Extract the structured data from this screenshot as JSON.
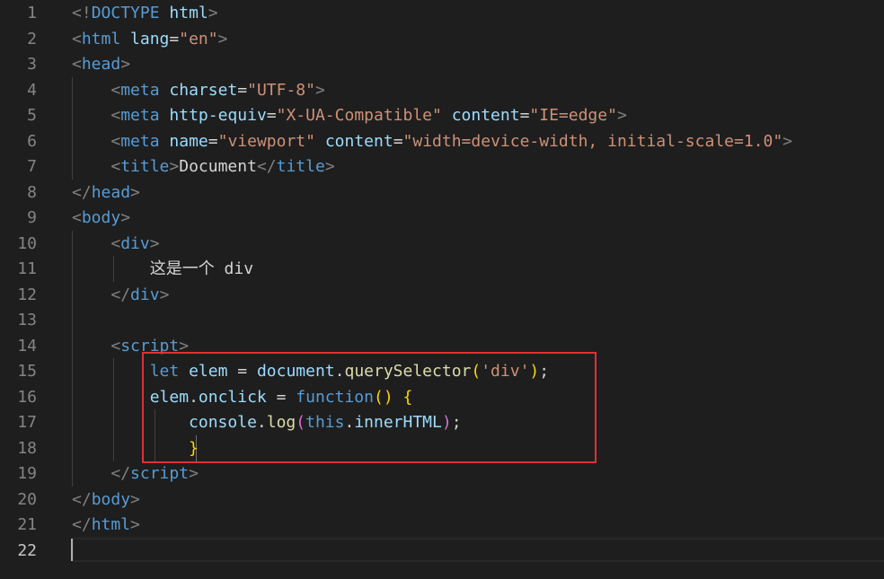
{
  "editor": {
    "theme": "dark",
    "accent": "#e03131",
    "current_line": 22,
    "highlight_box": {
      "from_line": 15,
      "to_line": 18
    },
    "lines": [
      {
        "num": "1",
        "tokens": [
          [
            "<!",
            "#808080"
          ],
          [
            "DOCTYPE",
            "#569cd6"
          ],
          [
            " ",
            "#d4d4d4"
          ],
          [
            "html",
            "#9cdcfe"
          ],
          [
            ">",
            "#808080"
          ]
        ]
      },
      {
        "num": "2",
        "tokens": [
          [
            "<",
            "#808080"
          ],
          [
            "html",
            "#569cd6"
          ],
          [
            " ",
            "#d4d4d4"
          ],
          [
            "lang",
            "#9cdcfe"
          ],
          [
            "=",
            "#d4d4d4"
          ],
          [
            "\"en\"",
            "#ce9178"
          ],
          [
            ">",
            "#808080"
          ]
        ]
      },
      {
        "num": "3",
        "tokens": [
          [
            "<",
            "#808080"
          ],
          [
            "head",
            "#569cd6"
          ],
          [
            ">",
            "#808080"
          ]
        ]
      },
      {
        "num": "4",
        "tokens": [
          [
            "    ",
            "#d4d4d4"
          ],
          [
            "<",
            "#808080"
          ],
          [
            "meta",
            "#569cd6"
          ],
          [
            " ",
            "#d4d4d4"
          ],
          [
            "charset",
            "#9cdcfe"
          ],
          [
            "=",
            "#d4d4d4"
          ],
          [
            "\"UTF-8\"",
            "#ce9178"
          ],
          [
            ">",
            "#808080"
          ]
        ]
      },
      {
        "num": "5",
        "tokens": [
          [
            "    ",
            "#d4d4d4"
          ],
          [
            "<",
            "#808080"
          ],
          [
            "meta",
            "#569cd6"
          ],
          [
            " ",
            "#d4d4d4"
          ],
          [
            "http-equiv",
            "#9cdcfe"
          ],
          [
            "=",
            "#d4d4d4"
          ],
          [
            "\"X-UA-Compatible\"",
            "#ce9178"
          ],
          [
            " ",
            "#d4d4d4"
          ],
          [
            "content",
            "#9cdcfe"
          ],
          [
            "=",
            "#d4d4d4"
          ],
          [
            "\"IE=edge\"",
            "#ce9178"
          ],
          [
            ">",
            "#808080"
          ]
        ]
      },
      {
        "num": "6",
        "tokens": [
          [
            "    ",
            "#d4d4d4"
          ],
          [
            "<",
            "#808080"
          ],
          [
            "meta",
            "#569cd6"
          ],
          [
            " ",
            "#d4d4d4"
          ],
          [
            "name",
            "#9cdcfe"
          ],
          [
            "=",
            "#d4d4d4"
          ],
          [
            "\"viewport\"",
            "#ce9178"
          ],
          [
            " ",
            "#d4d4d4"
          ],
          [
            "content",
            "#9cdcfe"
          ],
          [
            "=",
            "#d4d4d4"
          ],
          [
            "\"width=device-width, initial-scale=1.0\"",
            "#ce9178"
          ],
          [
            ">",
            "#808080"
          ]
        ]
      },
      {
        "num": "7",
        "tokens": [
          [
            "    ",
            "#d4d4d4"
          ],
          [
            "<",
            "#808080"
          ],
          [
            "title",
            "#569cd6"
          ],
          [
            ">",
            "#808080"
          ],
          [
            "Document",
            "#d4d4d4"
          ],
          [
            "</",
            "#808080"
          ],
          [
            "title",
            "#569cd6"
          ],
          [
            ">",
            "#808080"
          ]
        ]
      },
      {
        "num": "8",
        "tokens": [
          [
            "</",
            "#808080"
          ],
          [
            "head",
            "#569cd6"
          ],
          [
            ">",
            "#808080"
          ]
        ]
      },
      {
        "num": "9",
        "tokens": [
          [
            "<",
            "#808080"
          ],
          [
            "body",
            "#569cd6"
          ],
          [
            ">",
            "#808080"
          ]
        ]
      },
      {
        "num": "10",
        "tokens": [
          [
            "    ",
            "#d4d4d4"
          ],
          [
            "<",
            "#808080"
          ],
          [
            "div",
            "#569cd6"
          ],
          [
            ">",
            "#808080"
          ]
        ]
      },
      {
        "num": "11",
        "tokens": [
          [
            "        ",
            "#d4d4d4"
          ],
          [
            "这是一个 div",
            "#d4d4d4"
          ]
        ]
      },
      {
        "num": "12",
        "tokens": [
          [
            "    ",
            "#d4d4d4"
          ],
          [
            "</",
            "#808080"
          ],
          [
            "div",
            "#569cd6"
          ],
          [
            ">",
            "#808080"
          ]
        ]
      },
      {
        "num": "13",
        "tokens": []
      },
      {
        "num": "14",
        "tokens": [
          [
            "    ",
            "#d4d4d4"
          ],
          [
            "<",
            "#808080"
          ],
          [
            "script",
            "#569cd6"
          ],
          [
            ">",
            "#808080"
          ]
        ]
      },
      {
        "num": "15",
        "tokens": [
          [
            "        ",
            "#d4d4d4"
          ],
          [
            "let",
            "#569cd6"
          ],
          [
            " ",
            "#d4d4d4"
          ],
          [
            "elem",
            "#9cdcfe"
          ],
          [
            " = ",
            "#d4d4d4"
          ],
          [
            "document",
            "#9cdcfe"
          ],
          [
            ".",
            "#d4d4d4"
          ],
          [
            "querySelector",
            "#dcdcaa"
          ],
          [
            "(",
            "#ffd700"
          ],
          [
            "'div'",
            "#ce9178"
          ],
          [
            ")",
            "#ffd700"
          ],
          [
            ";",
            "#d4d4d4"
          ]
        ]
      },
      {
        "num": "16",
        "tokens": [
          [
            "        ",
            "#d4d4d4"
          ],
          [
            "elem",
            "#9cdcfe"
          ],
          [
            ".",
            "#d4d4d4"
          ],
          [
            "onclick",
            "#9cdcfe"
          ],
          [
            " = ",
            "#d4d4d4"
          ],
          [
            "function",
            "#569cd6"
          ],
          [
            "()",
            "#ffd700"
          ],
          [
            " ",
            "#d4d4d4"
          ],
          [
            "{",
            "#ffd700"
          ]
        ]
      },
      {
        "num": "17",
        "tokens": [
          [
            "            ",
            "#d4d4d4"
          ],
          [
            "console",
            "#9cdcfe"
          ],
          [
            ".",
            "#d4d4d4"
          ],
          [
            "log",
            "#dcdcaa"
          ],
          [
            "(",
            "#da70d6"
          ],
          [
            "this",
            "#569cd6"
          ],
          [
            ".",
            "#d4d4d4"
          ],
          [
            "innerHTML",
            "#9cdcfe"
          ],
          [
            ")",
            "#da70d6"
          ],
          [
            ";",
            "#d4d4d4"
          ]
        ]
      },
      {
        "num": "18",
        "tokens": [
          [
            "            ",
            "#d4d4d4"
          ],
          [
            "}",
            "#ffd700"
          ]
        ]
      },
      {
        "num": "19",
        "tokens": [
          [
            "    ",
            "#d4d4d4"
          ],
          [
            "</",
            "#808080"
          ],
          [
            "script",
            "#569cd6"
          ],
          [
            ">",
            "#808080"
          ]
        ]
      },
      {
        "num": "20",
        "tokens": [
          [
            "</",
            "#808080"
          ],
          [
            "body",
            "#569cd6"
          ],
          [
            ">",
            "#808080"
          ]
        ]
      },
      {
        "num": "21",
        "tokens": [
          [
            "</",
            "#808080"
          ],
          [
            "html",
            "#569cd6"
          ],
          [
            ">",
            "#808080"
          ]
        ]
      },
      {
        "num": "22",
        "tokens": []
      }
    ]
  }
}
